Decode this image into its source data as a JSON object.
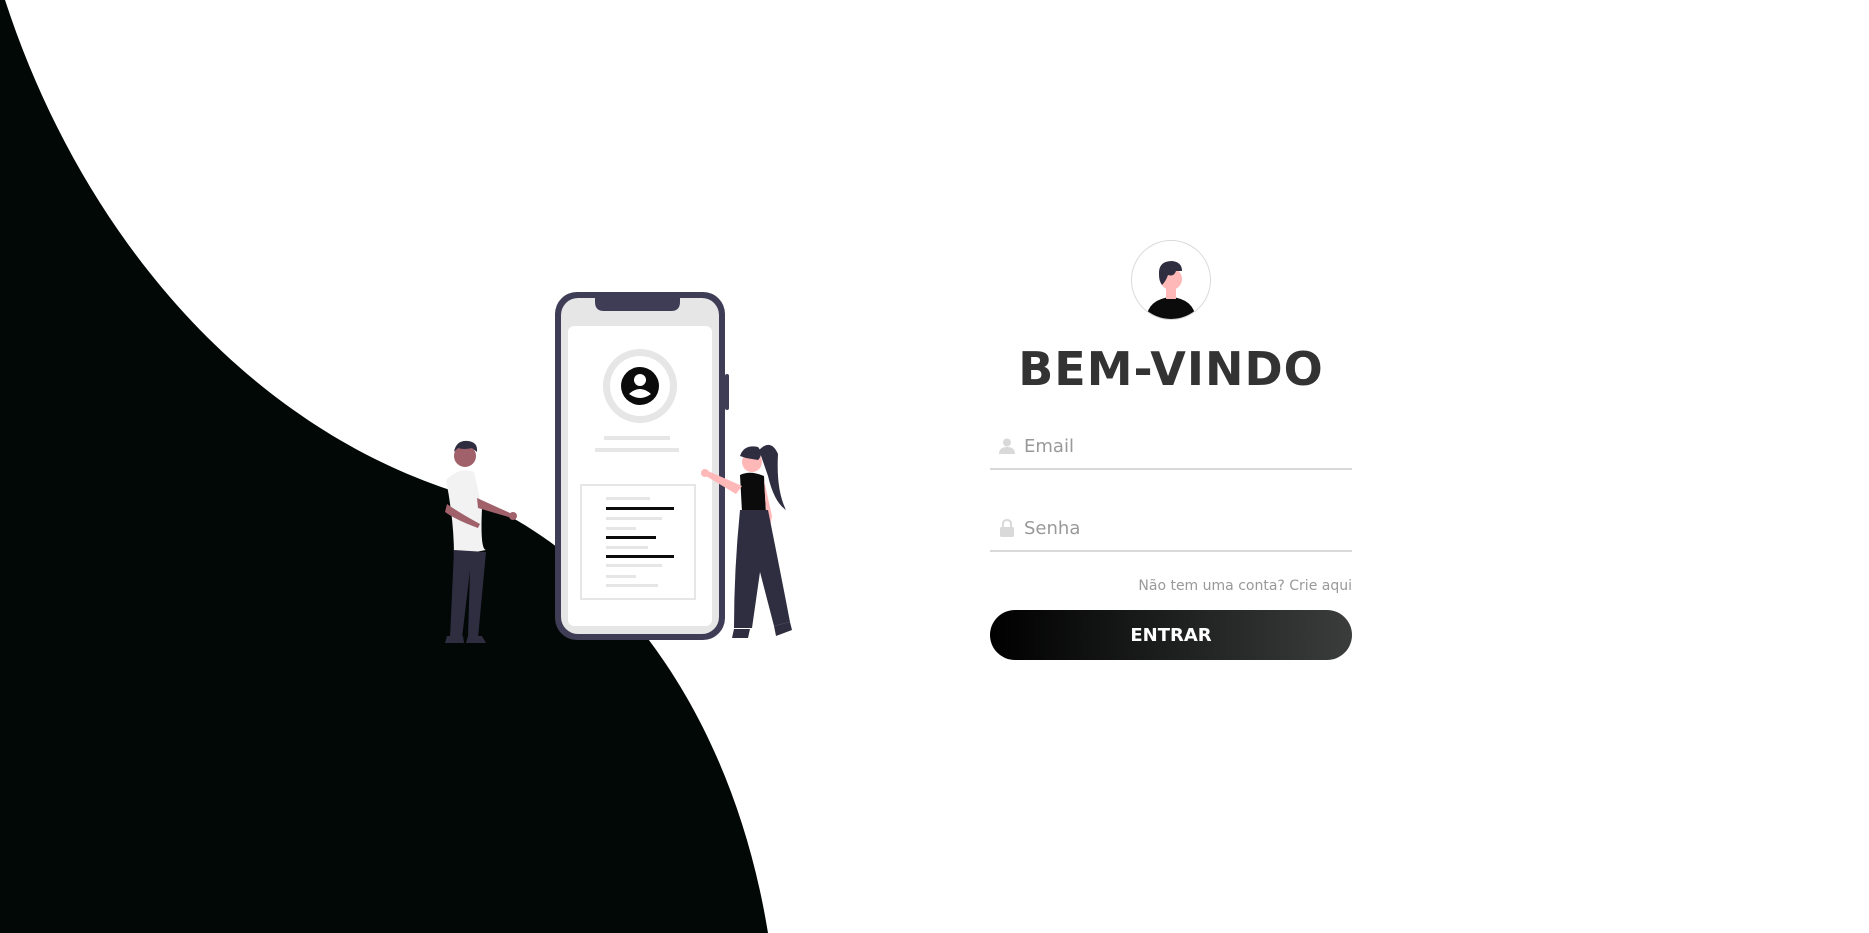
{
  "colors": {
    "wave": "#010806",
    "button_start": "#000000",
    "button_end": "#3b3d3d",
    "title": "#333333",
    "muted": "#999999",
    "underline": "#d9d9d9"
  },
  "illustration": {
    "name": "mobile-login-people-illustration"
  },
  "login": {
    "avatar_icon": "user-avatar-icon",
    "title": "BEM-VINDO",
    "email": {
      "icon": "user-icon",
      "placeholder": "Email",
      "value": ""
    },
    "password": {
      "icon": "lock-icon",
      "placeholder": "Senha",
      "value": ""
    },
    "signup_link": "Não tem uma conta? Crie aqui",
    "submit_label": "ENTRAR"
  }
}
